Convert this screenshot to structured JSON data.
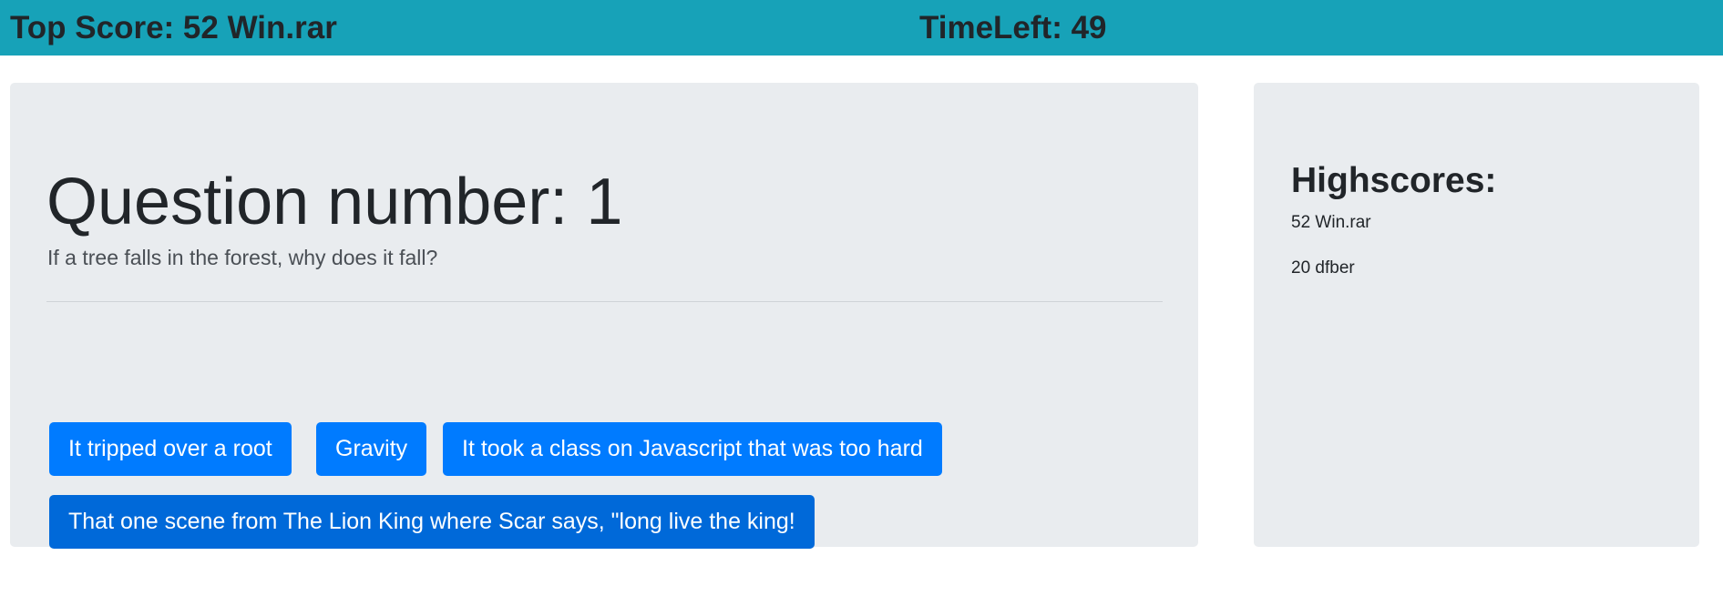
{
  "header": {
    "top_score": "Top Score: 52 Win.rar",
    "time_left": "TimeLeft: 49"
  },
  "question": {
    "title": "Question number: 1",
    "text": "If a tree falls in the forest, why does it fall?"
  },
  "answers": [
    "It tripped over a root",
    "Gravity",
    "It took a class on Javascript that was too hard",
    "That one scene from The Lion King where Scar says, \"long live the king!"
  ],
  "highscores": {
    "title": "Highscores:",
    "entries": [
      "52 Win.rar",
      "20 dfber"
    ]
  },
  "colors": {
    "header_bg": "#17a2b8",
    "panel_bg": "#e9ecef",
    "button_bg": "#007bff",
    "button_active_bg": "#0069d9"
  }
}
